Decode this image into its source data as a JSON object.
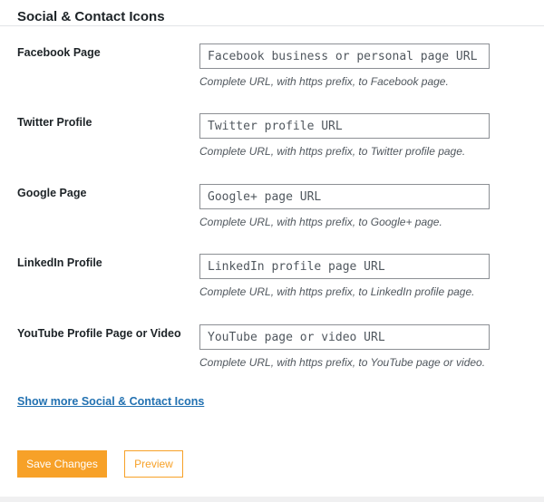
{
  "section": {
    "title": "Social & Contact Icons"
  },
  "fields": [
    {
      "label": "Facebook Page",
      "placeholder": "Facebook business or personal page URL",
      "value": "",
      "help": "Complete URL, with https prefix, to Facebook page."
    },
    {
      "label": "Twitter Profile",
      "placeholder": "Twitter profile URL",
      "value": "",
      "help": "Complete URL, with https prefix, to Twitter profile page."
    },
    {
      "label": "Google Page",
      "placeholder": "Google+ page URL",
      "value": "",
      "help": "Complete URL, with https prefix, to Google+ page."
    },
    {
      "label": "LinkedIn Profile",
      "placeholder": "LinkedIn profile page URL",
      "value": "",
      "help": "Complete URL, with https prefix, to LinkedIn profile page."
    },
    {
      "label": "YouTube Profile Page or Video",
      "placeholder": "YouTube page or video URL",
      "value": "",
      "help": "Complete URL, with https prefix, to YouTube page or video."
    }
  ],
  "links": {
    "show_more": "Show more Social & Contact Icons"
  },
  "actions": {
    "save_label": "Save Changes",
    "preview_label": "Preview"
  },
  "colors": {
    "accent": "#f7a128",
    "link": "#2271b1",
    "input_border": "#8c8f94",
    "help_text": "#50575e",
    "heading_text": "#1d2327"
  }
}
